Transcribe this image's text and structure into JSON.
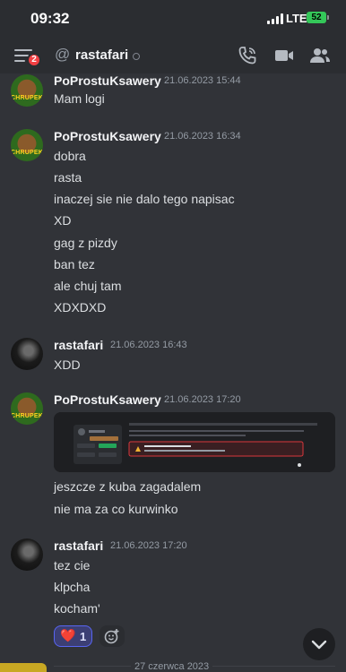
{
  "status_bar": {
    "time": "09:32",
    "network": "LTE",
    "battery": "52"
  },
  "header": {
    "badge_count": "2",
    "channel": "rastafari"
  },
  "messages": [
    {
      "author": "PoProstuKsawery",
      "timestamp": "21.06.2023 15:44",
      "avatar": "chrupek",
      "lines": [
        "Mam logi"
      ]
    },
    {
      "author": "PoProstuKsawery",
      "timestamp": "21.06.2023 16:34",
      "avatar": "chrupek",
      "lines": [
        "dobra",
        "rasta",
        "inaczej sie nie dalo tego napisac",
        "XD",
        "gag z pizdy",
        "ban tez",
        "ale chuj tam",
        "XDXDXD"
      ]
    },
    {
      "author": "rastafari",
      "timestamp": "21.06.2023 16:43",
      "avatar": "rasta",
      "lines": [
        "XDD"
      ]
    },
    {
      "author": "PoProstuKsawery",
      "timestamp": "21.06.2023 17:20",
      "avatar": "chrupek",
      "lines": [
        "jeszcze z kuba zagadalem",
        "nie ma za co kurwinko"
      ]
    },
    {
      "author": "rastafari",
      "timestamp": "21.06.2023 17:20",
      "avatar": "rasta",
      "lines": [
        "tez cie",
        "klpcha",
        "kocham'"
      ]
    }
  ],
  "avatar_text": {
    "chrupek": "CHRUPEK"
  },
  "reaction": {
    "emoji": "❤️",
    "count": "1"
  },
  "date_divider": "27 czerwca 2023",
  "colors": {
    "background": "#313338",
    "header": "#2b2d31",
    "accent": "#5865f2",
    "badge": "#f23f43"
  }
}
